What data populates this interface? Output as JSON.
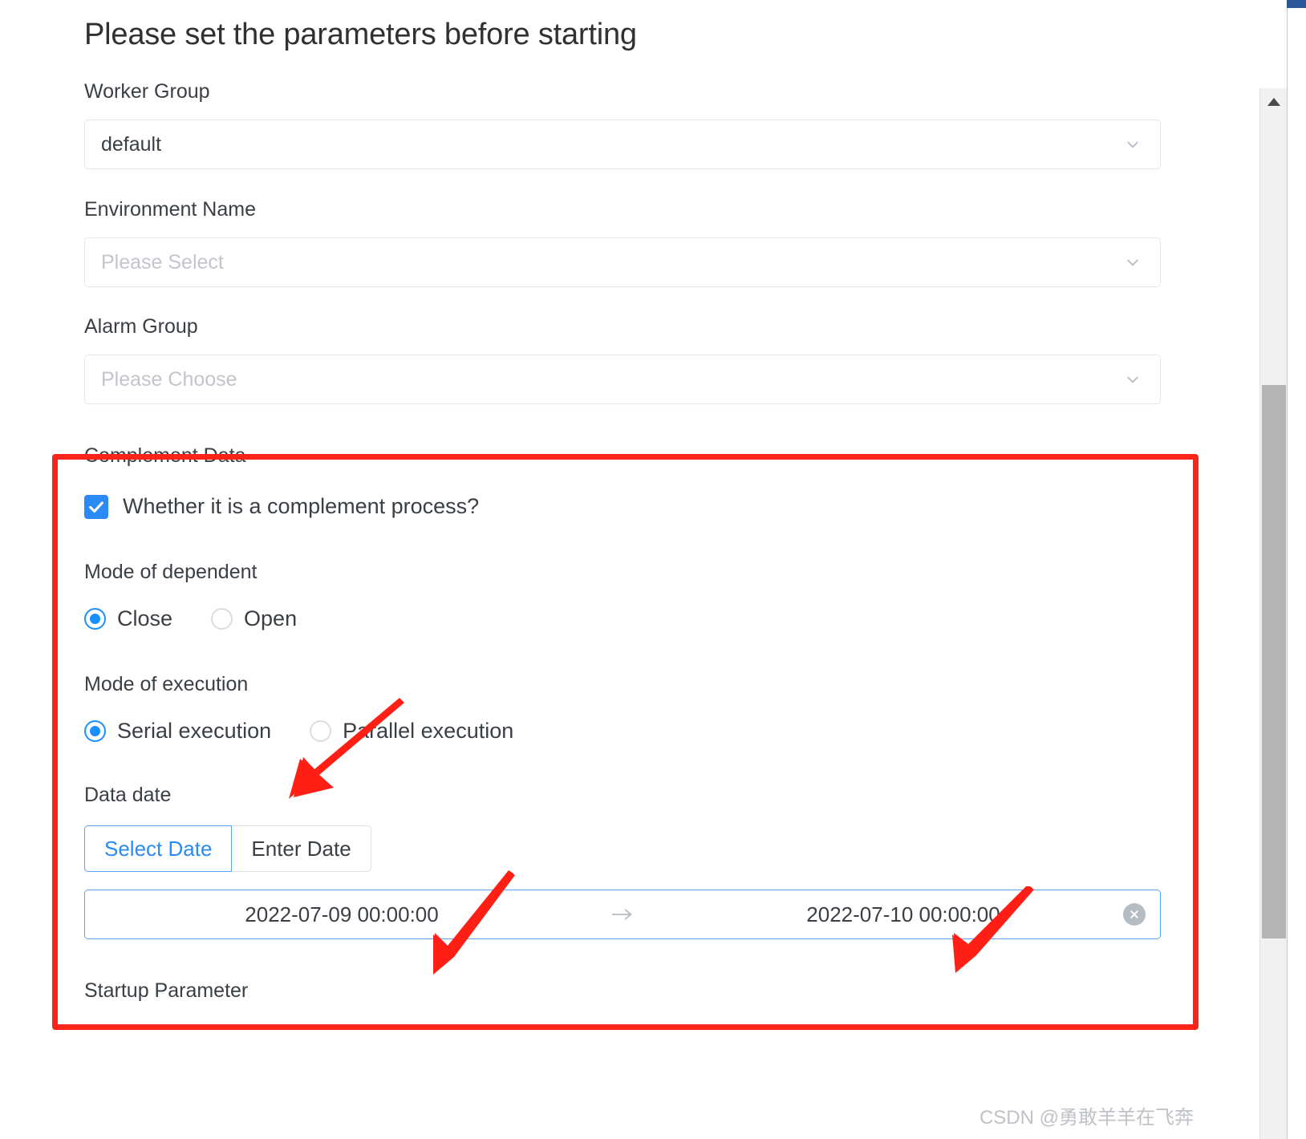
{
  "dialog": {
    "title": "Please set the parameters before starting"
  },
  "fields": {
    "worker_group": {
      "label": "Worker Group",
      "value": "default"
    },
    "environment_name": {
      "label": "Environment Name",
      "placeholder": "Please Select"
    },
    "alarm_group": {
      "label": "Alarm Group",
      "placeholder": "Please Choose"
    },
    "startup_parameter": {
      "label": "Startup Parameter"
    }
  },
  "complement": {
    "section_label": "Complement Data",
    "checkbox_label": "Whether it is a complement process?",
    "checkbox_checked": true,
    "dependent": {
      "label": "Mode of dependent",
      "options": [
        "Close",
        "Open"
      ],
      "selected": "Close"
    },
    "execution": {
      "label": "Mode of execution",
      "options": [
        "Serial execution",
        "Parallel execution"
      ],
      "selected": "Serial execution"
    },
    "data_date": {
      "label": "Data date",
      "tabs": [
        "Select Date",
        "Enter Date"
      ],
      "active_tab": "Select Date",
      "start": "2022-07-09 00:00:00",
      "end": "2022-07-10 00:00:00",
      "separator": "→"
    }
  },
  "annotation": {
    "box_color": "#fc2419",
    "arrow_color": "#ff1f15"
  },
  "watermark": {
    "text": "CSDN @勇敢羊羊在飞奔"
  },
  "colors": {
    "accent": "#2a8af6",
    "text": "#3a3f45",
    "placeholder": "#c2c6cc",
    "border": "#e4e7ed"
  }
}
